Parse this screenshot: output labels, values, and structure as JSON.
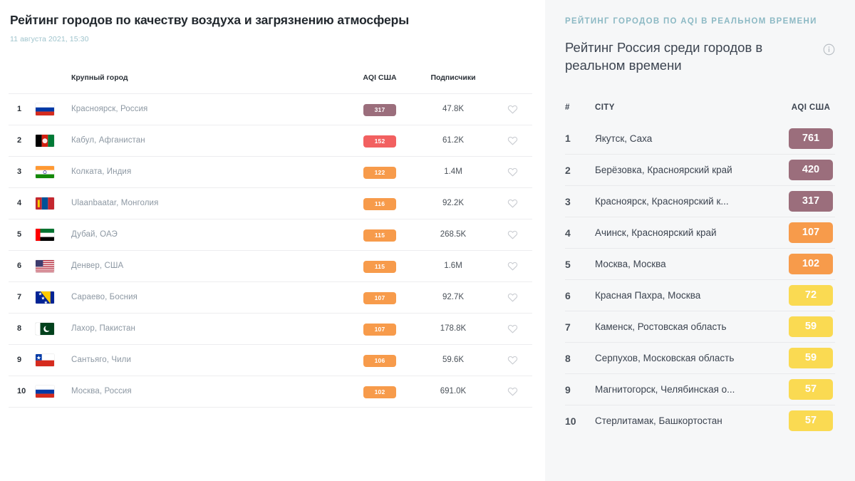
{
  "left": {
    "title": "Рейтинг городов по качеству воздуха и загрязнению атмосферы",
    "date": "11 августа 2021, 15:30",
    "columns": {
      "city": "Крупный город",
      "aqi": "AQI США",
      "subscribers": "Подписчики"
    },
    "rows": [
      {
        "rank": "1",
        "city": "Красноярск, Россия",
        "aqi": "317",
        "aqi_color": "#9b6e7c",
        "subs": "47.8K",
        "flag": "ru"
      },
      {
        "rank": "2",
        "city": "Кабул, Афганистан",
        "aqi": "152",
        "aqi_color": "#f26060",
        "subs": "61.2K",
        "flag": "af"
      },
      {
        "rank": "3",
        "city": "Колката, Индия",
        "aqi": "122",
        "aqi_color": "#f79b4b",
        "subs": "1.4M",
        "flag": "in"
      },
      {
        "rank": "4",
        "city": "Ulaanbaatar, Монголия",
        "aqi": "116",
        "aqi_color": "#f79b4b",
        "subs": "92.2K",
        "flag": "mn"
      },
      {
        "rank": "5",
        "city": "Дубай, ОАЭ",
        "aqi": "115",
        "aqi_color": "#f79b4b",
        "subs": "268.5K",
        "flag": "ae"
      },
      {
        "rank": "6",
        "city": "Денвер, США",
        "aqi": "115",
        "aqi_color": "#f79b4b",
        "subs": "1.6M",
        "flag": "us"
      },
      {
        "rank": "7",
        "city": "Сараево, Босния",
        "aqi": "107",
        "aqi_color": "#f79b4b",
        "subs": "92.7K",
        "flag": "ba"
      },
      {
        "rank": "8",
        "city": "Лахор, Пакистан",
        "aqi": "107",
        "aqi_color": "#f79b4b",
        "subs": "178.8K",
        "flag": "pk"
      },
      {
        "rank": "9",
        "city": "Сантьяго, Чили",
        "aqi": "106",
        "aqi_color": "#f79b4b",
        "subs": "59.6K",
        "flag": "cl"
      },
      {
        "rank": "10",
        "city": "Москва, Россия",
        "aqi": "102",
        "aqi_color": "#f79b4b",
        "subs": "691.0K",
        "flag": "ru"
      }
    ]
  },
  "right": {
    "kicker": "Рейтинг городов по AQI в реальном времени",
    "title": "Рейтинг Россия среди городов в реальном времени",
    "columns": {
      "rank": "#",
      "city": "CITY",
      "aqi": "AQI США"
    },
    "rows": [
      {
        "rank": "1",
        "city": "Якутск, Саха",
        "aqi": "761",
        "aqi_color": "#9b6e7c"
      },
      {
        "rank": "2",
        "city": "Берёзовка, Красноярский край",
        "aqi": "420",
        "aqi_color": "#9b6e7c"
      },
      {
        "rank": "3",
        "city": "Красноярск, Красноярский к...",
        "aqi": "317",
        "aqi_color": "#9b6e7c"
      },
      {
        "rank": "4",
        "city": "Ачинск, Красноярский край",
        "aqi": "107",
        "aqi_color": "#f79b4b"
      },
      {
        "rank": "5",
        "city": "Москва, Москва",
        "aqi": "102",
        "aqi_color": "#f79b4b"
      },
      {
        "rank": "6",
        "city": "Красная Пахра, Москва",
        "aqi": "72",
        "aqi_color": "#fad košice"
      },
      {
        "rank": "7",
        "city": "Каменск, Ростовская область",
        "aqi": "59",
        "aqi_color": "#fada52"
      },
      {
        "rank": "8",
        "city": "Серпухов, Московская область",
        "aqi": "59",
        "aqi_color": "#fada52"
      },
      {
        "rank": "9",
        "city": "Магнитогорск, Челябинская о...",
        "aqi": "57",
        "aqi_color": "#fada52"
      },
      {
        "rank": "10",
        "city": "Стерлитамак, Башкортостан",
        "aqi": "57",
        "aqi_color": "#fada52"
      }
    ]
  },
  "colors": {
    "maroon": "#9b6e7c",
    "red": "#f26060",
    "orange": "#f79b4b",
    "yellow": "#fada52",
    "teal_kicker": "#8cb9c4",
    "panel_bg": "#f6f7f8"
  }
}
